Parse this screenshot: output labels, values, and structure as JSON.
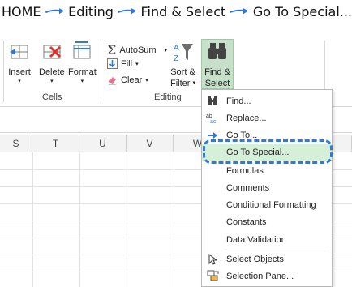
{
  "breadcrumb": {
    "steps": [
      "HOME",
      "Editing",
      "Find & Select",
      "Go To Special..."
    ],
    "arrow_color": "#2f7ad6"
  },
  "ribbon": {
    "cells_group": {
      "label": "Cells",
      "insert_label": "Insert",
      "delete_label": "Delete",
      "format_label": "Format"
    },
    "editing_group": {
      "label": "Editing",
      "autosum_label": "AutoSum",
      "fill_label": "Fill",
      "clear_label": "Clear",
      "sort_filter_label_1": "Sort &",
      "sort_filter_label_2": "Filter",
      "find_select_label_1": "Find &",
      "find_select_label_2": "Select"
    }
  },
  "grid": {
    "columns": [
      "S",
      "T",
      "U",
      "V",
      "W"
    ]
  },
  "menu": {
    "items": [
      {
        "label": "Find...",
        "icon": "binoculars-icon"
      },
      {
        "label": "Replace...",
        "icon": "replace-icon"
      },
      {
        "label": "Go To...",
        "icon": "arrow-right-icon"
      },
      {
        "label": "Go To Special...",
        "icon": ""
      },
      {
        "label": "Formulas",
        "icon": ""
      },
      {
        "label": "Comments",
        "icon": ""
      },
      {
        "label": "Conditional Formatting",
        "icon": ""
      },
      {
        "label": "Constants",
        "icon": ""
      },
      {
        "label": "Data Validation",
        "icon": ""
      },
      {
        "label": "Select Objects",
        "icon": "pointer-icon"
      },
      {
        "label": "Selection Pane...",
        "icon": "selection-pane-icon"
      }
    ],
    "highlight_color": "#d6efd9",
    "dash_color": "#2f7ad6"
  }
}
